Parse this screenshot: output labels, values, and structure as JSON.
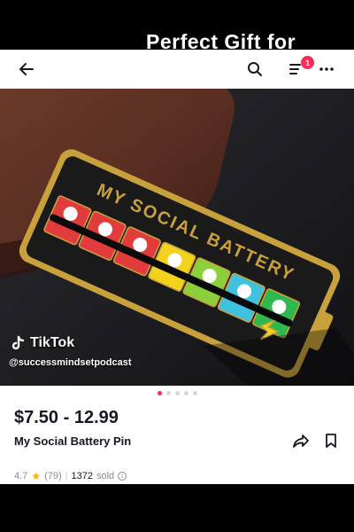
{
  "banner": {
    "text": "Perfect Gift for"
  },
  "header": {
    "back_icon": "arrow-left-icon",
    "search_icon": "search-icon",
    "list_icon": "list-icon",
    "more_icon": "more-dots-icon",
    "cart_badge": "1"
  },
  "product": {
    "image": {
      "pin_text": "MY SOCIAL BATTERY",
      "segment_colors": [
        "#e23b3b",
        "#e23b3b",
        "#e23b3b",
        "#f2d21a",
        "#8bcf3a",
        "#3ec2e0",
        "#2eb84d"
      ]
    },
    "carousel": {
      "count": 5,
      "active": 0
    },
    "price": "$7.50 - 12.99",
    "title": "My Social Battery Pin",
    "rating": "4.7",
    "reviews": "(79)",
    "sold_count": "1372",
    "sold_label": "sold"
  },
  "watermark": {
    "brand": "TikTok",
    "handle": "@successmindsetpodcast"
  },
  "colors": {
    "accent": "#fe2c55",
    "star": "#f5b400",
    "text": "#161823",
    "muted": "#8a8b91"
  }
}
